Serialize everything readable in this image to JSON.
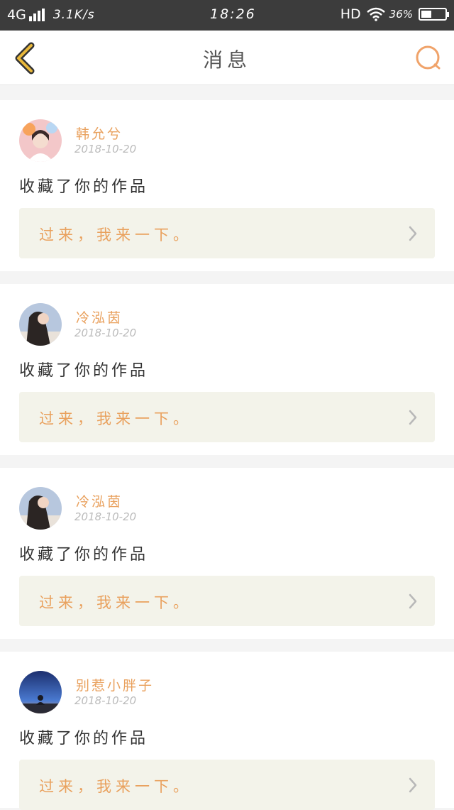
{
  "status_bar": {
    "network": "4G",
    "speed": "3.1K/s",
    "time": "18:26",
    "hd": "HD",
    "battery": "36%"
  },
  "nav": {
    "title": "消息",
    "accent": "#e9b83a",
    "search_color": "#f0a36a"
  },
  "messages": [
    {
      "name": "韩允兮",
      "date": "2018-10-20",
      "action": "收藏了你的作品",
      "reply": "过来，我来一下。"
    },
    {
      "name": "冷泓茵",
      "date": "2018-10-20",
      "action": "收藏了你的作品",
      "reply": "过来，我来一下。"
    },
    {
      "name": "冷泓茵",
      "date": "2018-10-20",
      "action": "收藏了你的作品",
      "reply": "过来，我来一下。"
    },
    {
      "name": "别惹小胖子",
      "date": "2018-10-20",
      "action": "收藏了你的作品",
      "reply": "过来，我来一下。"
    }
  ]
}
